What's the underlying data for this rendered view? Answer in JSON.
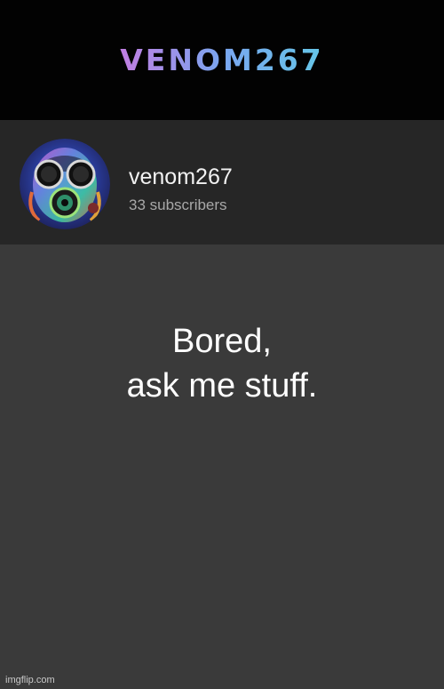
{
  "banner": {
    "title": "VENOM267"
  },
  "channel": {
    "name": "venom267",
    "subscribers": "33 subscribers",
    "avatar_icon": "gas-mask-icon"
  },
  "post": {
    "line1": "Bored,",
    "line2": "ask me stuff."
  },
  "watermark": {
    "text": "imgflip.com"
  },
  "colors": {
    "banner_bg": "#020202",
    "channel_bg": "#262626",
    "post_bg": "#3a3a3a",
    "banner_gradient": [
      "#e07ad6",
      "#7aa6f0",
      "#63c9e6"
    ]
  }
}
